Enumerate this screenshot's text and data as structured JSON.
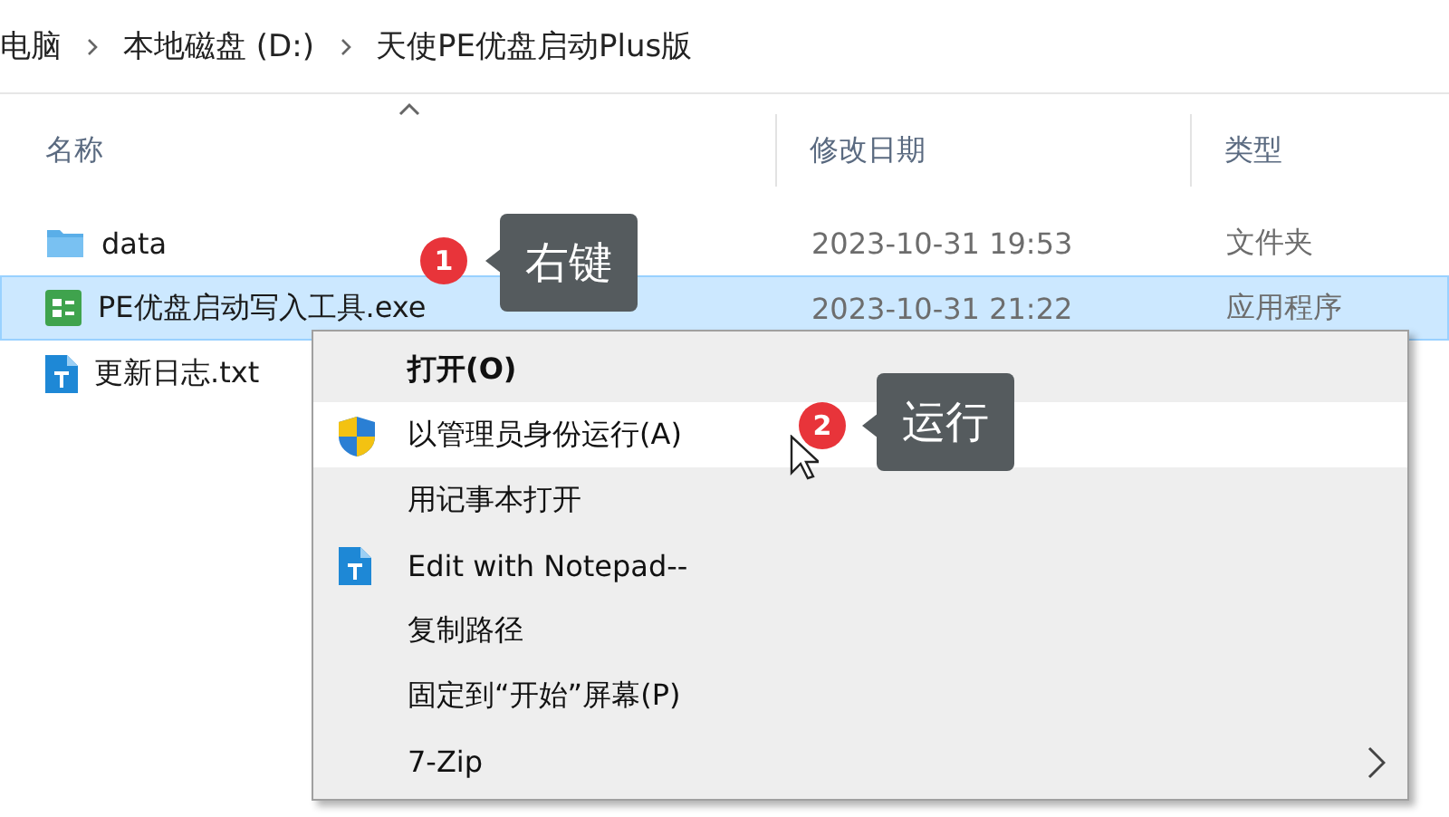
{
  "breadcrumb": [
    {
      "label": "电脑"
    },
    {
      "label": "本地磁盘 (D:)"
    },
    {
      "label": "天使PE优盘启动Plus版"
    }
  ],
  "columns": [
    {
      "label": "名称",
      "sorted": true
    },
    {
      "label": "修改日期",
      "sorted": false
    },
    {
      "label": "类型",
      "sorted": false
    }
  ],
  "files": [
    {
      "name": "data",
      "date": "2023-10-31 19:53",
      "type": "文件夹",
      "kind": "folder",
      "selected": false
    },
    {
      "name": "PE优盘启动写入工具.exe",
      "date": "2023-10-31 21:22",
      "type": "应用程序",
      "kind": "app",
      "selected": true
    },
    {
      "name": "更新日志.txt",
      "kind": "text",
      "selected": false
    }
  ],
  "context_menu": {
    "items": [
      {
        "label": "打开(O)",
        "bold": true,
        "highlighted": false,
        "submenu": false
      },
      {
        "label": "以管理员身份运行(A)",
        "kind": "shield",
        "bold": false,
        "highlighted": true,
        "submenu": false
      },
      {
        "label": "用记事本打开",
        "bold": false,
        "highlighted": false,
        "submenu": false
      },
      {
        "label": "Edit with Notepad--",
        "kind": "text",
        "bold": false,
        "highlighted": false,
        "submenu": false
      },
      {
        "label": "复制路径",
        "bold": false,
        "highlighted": false,
        "submenu": false
      },
      {
        "label": "固定到“开始”屏幕(P)",
        "bold": false,
        "highlighted": false,
        "submenu": false
      },
      {
        "label": "7-Zip",
        "bold": false,
        "highlighted": false,
        "submenu": true
      }
    ]
  },
  "annotations": [
    {
      "number": "1",
      "label": "右键"
    },
    {
      "number": "2",
      "label": "运行"
    }
  ]
}
